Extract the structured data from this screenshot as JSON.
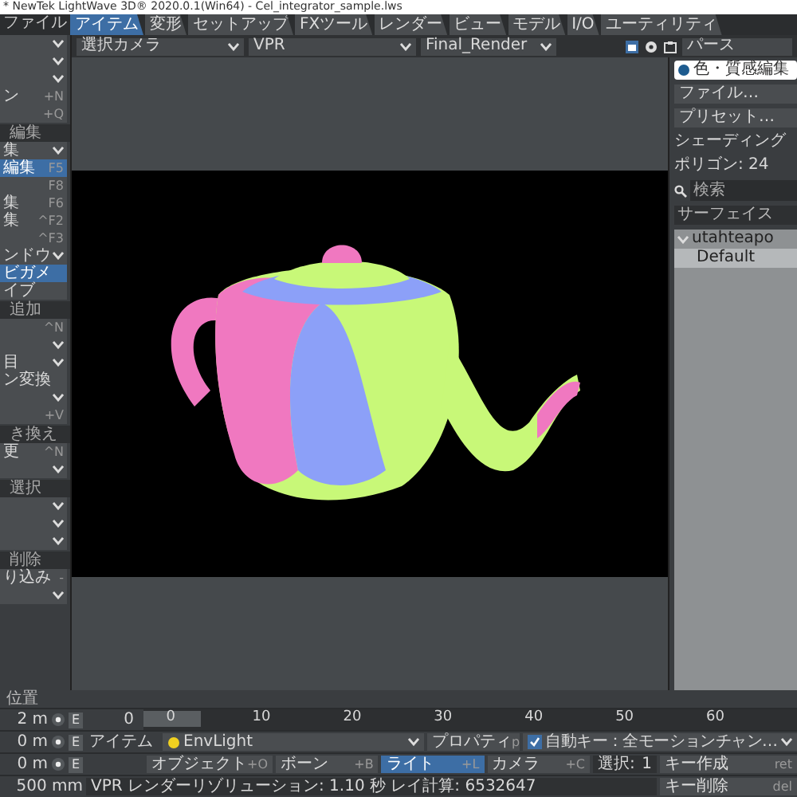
{
  "title_bar": {
    "title": "* NewTek LightWave 3D® 2020.0.1(Win64) - Cel_integrator_sample.lws"
  },
  "menu": {
    "label": "ファイル"
  },
  "tabs": [
    {
      "label": "アイテム",
      "selected": true
    },
    {
      "label": "変形",
      "selected": false
    },
    {
      "label": "セットアップ",
      "selected": false
    },
    {
      "label": "FXツール",
      "selected": false
    },
    {
      "label": "レンダー",
      "selected": false
    },
    {
      "label": "ビュー",
      "selected": false
    },
    {
      "label": "モデル",
      "selected": false
    },
    {
      "label": "I/O",
      "selected": false
    },
    {
      "label": "ユーティリティ",
      "selected": false
    }
  ],
  "viewport_header": {
    "camera": "選択カメラ",
    "mode": "VPR",
    "render": "Final_Render"
  },
  "left_panel": [
    {
      "kind": "dropdown"
    },
    {
      "kind": "dropdown"
    },
    {
      "kind": "dropdown"
    },
    {
      "kind": "item",
      "label": "ン",
      "shortcut": "+N",
      "selected": false
    },
    {
      "kind": "item",
      "shortcut": "+Q",
      "selected": false
    },
    {
      "kind": "header",
      "label": "編集"
    },
    {
      "kind": "dropdown",
      "label": "集"
    },
    {
      "kind": "item",
      "label": "編集",
      "shortcut": "F5",
      "selected": true
    },
    {
      "kind": "item",
      "shortcut": "F8",
      "selected": false
    },
    {
      "kind": "item",
      "label": "集",
      "shortcut": "F6",
      "selected": false
    },
    {
      "kind": "item",
      "label": "集",
      "shortcut": "^F2",
      "selected": false
    },
    {
      "kind": "item",
      "shortcut": "^F3",
      "selected": false
    },
    {
      "kind": "dropdown",
      "label": "ンドウ"
    },
    {
      "kind": "item",
      "label": "ビガメ",
      "selected": true
    },
    {
      "kind": "item",
      "label": "イブ",
      "selected": false
    },
    {
      "kind": "header",
      "label": "追加"
    },
    {
      "kind": "item",
      "shortcut": "^N",
      "selected": false
    },
    {
      "kind": "dropdown"
    },
    {
      "kind": "dropdown",
      "label": "目"
    },
    {
      "kind": "item",
      "label": "ン変換",
      "selected": false
    },
    {
      "kind": "dropdown"
    },
    {
      "kind": "item",
      "shortcut": "+V",
      "selected": false
    },
    {
      "kind": "header",
      "label": "き換え"
    },
    {
      "kind": "item",
      "label": "更",
      "shortcut": "^N",
      "selected": false
    },
    {
      "kind": "dropdown"
    },
    {
      "kind": "header",
      "label": "選択"
    },
    {
      "kind": "dropdown"
    },
    {
      "kind": "dropdown"
    },
    {
      "kind": "dropdown"
    },
    {
      "kind": "header",
      "label": "削除"
    },
    {
      "kind": "item",
      "label": "り込み",
      "shortcut": "-",
      "selected": false
    },
    {
      "kind": "dropdown"
    }
  ],
  "right_panel": {
    "title": "パース",
    "editor_button": "色・質感編集",
    "file_button": "ファイル…",
    "preset_button": "プリセット…",
    "info_lines": [
      "シェーディング",
      "ポリゴン: 24"
    ],
    "search": {
      "placeholder": "検索"
    },
    "section": "サーフェイス",
    "tree": [
      {
        "label": "utahteapo",
        "expanded": true,
        "selected": false,
        "children": [
          {
            "label": "Default",
            "selected": true
          }
        ]
      }
    ]
  },
  "position_label": "位置",
  "channels": [
    {
      "value": "2 m",
      "edit": "E"
    },
    {
      "value": "0 m",
      "edit": "E"
    },
    {
      "value": "0 m",
      "edit": "E"
    }
  ],
  "grid_size": "500 mm",
  "timeline": {
    "frame": "0",
    "labels": [
      "0",
      "10",
      "20",
      "30",
      "40",
      "50",
      "60"
    ]
  },
  "item_label": "アイテム",
  "current_item": "EnvLight",
  "properties": {
    "label": "プロパティ",
    "shortcut": "p"
  },
  "auto_key": {
    "label": "自動キー：全モーションチャン…",
    "checked": true
  },
  "item_types": [
    {
      "label": "オブジェクト",
      "shortcut": "+O",
      "selected": false
    },
    {
      "label": "ボーン",
      "shortcut": "+B",
      "selected": false
    },
    {
      "label": "ライト",
      "shortcut": "+L",
      "selected": true
    },
    {
      "label": "カメラ",
      "shortcut": "+C",
      "selected": false
    }
  ],
  "selection": {
    "label": "選択:",
    "value": "1"
  },
  "key_buttons": [
    {
      "label": "キー作成",
      "shortcut": "ret"
    },
    {
      "label": "キー削除",
      "shortcut": "del"
    }
  ],
  "status": "VPR レンダーリゾリューション: 1.10 秒 レイ計算: 6532647"
}
